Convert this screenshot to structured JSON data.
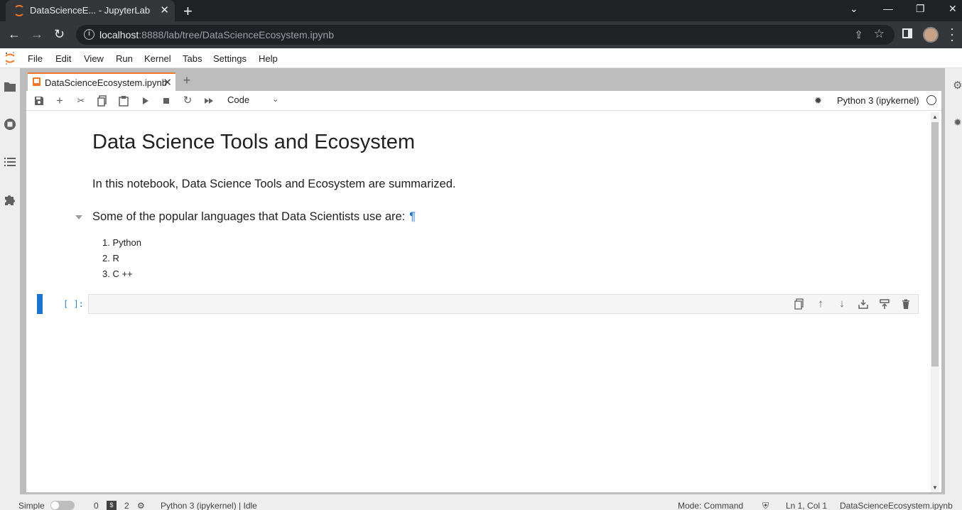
{
  "browser": {
    "tab_title": "DataScienceE... - JupyterLab",
    "url_host": "localhost",
    "url_rest": ":8888/lab/tree/DataScienceEcosystem.ipynb",
    "new_tab_symbol": "+"
  },
  "menubar": {
    "items": [
      "File",
      "Edit",
      "View",
      "Run",
      "Kernel",
      "Tabs",
      "Settings",
      "Help"
    ]
  },
  "dock": {
    "tab_label": "DataScienceEcosystem.ipynb",
    "add_tab_symbol": "+"
  },
  "toolbar": {
    "cell_type": "Code",
    "kernel_name": "Python 3 (ipykernel)"
  },
  "notebook": {
    "heading": "Data Science Tools and Ecosystem",
    "intro": "In this notebook, Data Science Tools and Ecosystem are summarized.",
    "subheading": "Some of the popular languages that Data Scientists use are:",
    "anchor": "¶",
    "languages": [
      "Python",
      "R",
      "C ++"
    ],
    "prompt": "[ ]:"
  },
  "statusbar": {
    "mode_label": "Simple",
    "terminals_count": "0",
    "kernels_count": "2",
    "kernel_status": "Python 3 (ipykernel) | Idle",
    "mode": "Mode: Command",
    "cursor": "Ln 1, Col 1",
    "filename": "DataScienceEcosystem.ipynb"
  },
  "colors": {
    "accent": "#f37726",
    "active_cell": "#1976d2"
  }
}
